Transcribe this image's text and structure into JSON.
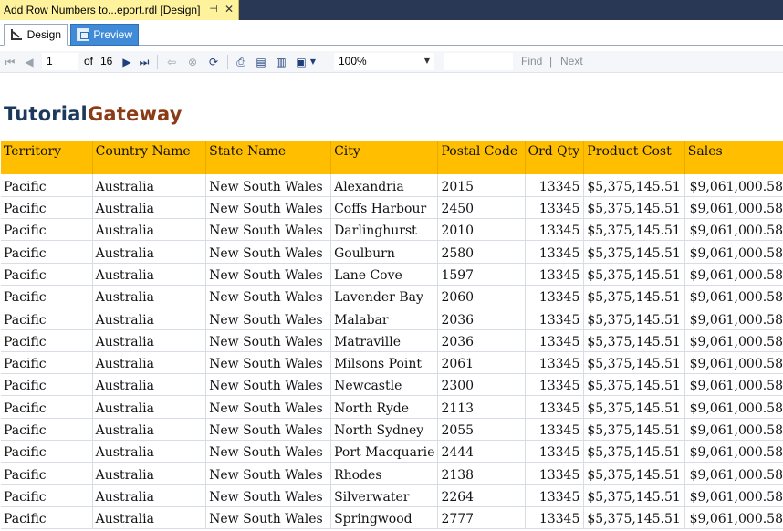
{
  "document_tab": {
    "title": "Add Row Numbers to...eport.rdl [Design]",
    "pin_icon": "pin-icon",
    "close_icon": "close-icon"
  },
  "view_tabs": [
    {
      "label": "Design",
      "icon": "design-icon"
    },
    {
      "label": "Preview",
      "icon": "preview-icon"
    }
  ],
  "toolbar": {
    "page_current": "1",
    "page_of_label": "of",
    "page_total": "16",
    "zoom": "100%",
    "find_label": "Find",
    "separator": "|",
    "next_label": "Next",
    "accent_color": "#3f8bd8"
  },
  "logo": {
    "part1": "Tutorial",
    "part2": "Gateway",
    "color1": "#1b3a5b",
    "color2": "#8b3b16"
  },
  "report": {
    "header_color": "#ffbf00",
    "columns": [
      "Territory",
      "Country Name",
      "State Name",
      "City",
      "Postal Code",
      "Ord Qty",
      "Product Cost",
      "Sales"
    ],
    "rows": [
      [
        "Pacific",
        "Australia",
        "New South Wales",
        "Alexandria",
        "2015",
        "13345",
        "$5,375,145.51",
        "$9,061,000.58"
      ],
      [
        "Pacific",
        "Australia",
        "New South Wales",
        "Coffs Harbour",
        "2450",
        "13345",
        "$5,375,145.51",
        "$9,061,000.58"
      ],
      [
        "Pacific",
        "Australia",
        "New South Wales",
        "Darlinghurst",
        "2010",
        "13345",
        "$5,375,145.51",
        "$9,061,000.58"
      ],
      [
        "Pacific",
        "Australia",
        "New South Wales",
        "Goulburn",
        "2580",
        "13345",
        "$5,375,145.51",
        "$9,061,000.58"
      ],
      [
        "Pacific",
        "Australia",
        "New South Wales",
        "Lane Cove",
        "1597",
        "13345",
        "$5,375,145.51",
        "$9,061,000.58"
      ],
      [
        "Pacific",
        "Australia",
        "New South Wales",
        "Lavender Bay",
        "2060",
        "13345",
        "$5,375,145.51",
        "$9,061,000.58"
      ],
      [
        "Pacific",
        "Australia",
        "New South Wales",
        "Malabar",
        "2036",
        "13345",
        "$5,375,145.51",
        "$9,061,000.58"
      ],
      [
        "Pacific",
        "Australia",
        "New South Wales",
        "Matraville",
        "2036",
        "13345",
        "$5,375,145.51",
        "$9,061,000.58"
      ],
      [
        "Pacific",
        "Australia",
        "New South Wales",
        "Milsons Point",
        "2061",
        "13345",
        "$5,375,145.51",
        "$9,061,000.58"
      ],
      [
        "Pacific",
        "Australia",
        "New South Wales",
        "Newcastle",
        "2300",
        "13345",
        "$5,375,145.51",
        "$9,061,000.58"
      ],
      [
        "Pacific",
        "Australia",
        "New South Wales",
        "North Ryde",
        "2113",
        "13345",
        "$5,375,145.51",
        "$9,061,000.58"
      ],
      [
        "Pacific",
        "Australia",
        "New South Wales",
        "North Sydney",
        "2055",
        "13345",
        "$5,375,145.51",
        "$9,061,000.58"
      ],
      [
        "Pacific",
        "Australia",
        "New South Wales",
        "Port Macquarie",
        "2444",
        "13345",
        "$5,375,145.51",
        "$9,061,000.58"
      ],
      [
        "Pacific",
        "Australia",
        "New South Wales",
        "Rhodes",
        "2138",
        "13345",
        "$5,375,145.51",
        "$9,061,000.58"
      ],
      [
        "Pacific",
        "Australia",
        "New South Wales",
        "Silverwater",
        "2264",
        "13345",
        "$5,375,145.51",
        "$9,061,000.58"
      ],
      [
        "Pacific",
        "Australia",
        "New South Wales",
        "Springwood",
        "2777",
        "13345",
        "$5,375,145.51",
        "$9,061,000.58"
      ]
    ]
  }
}
